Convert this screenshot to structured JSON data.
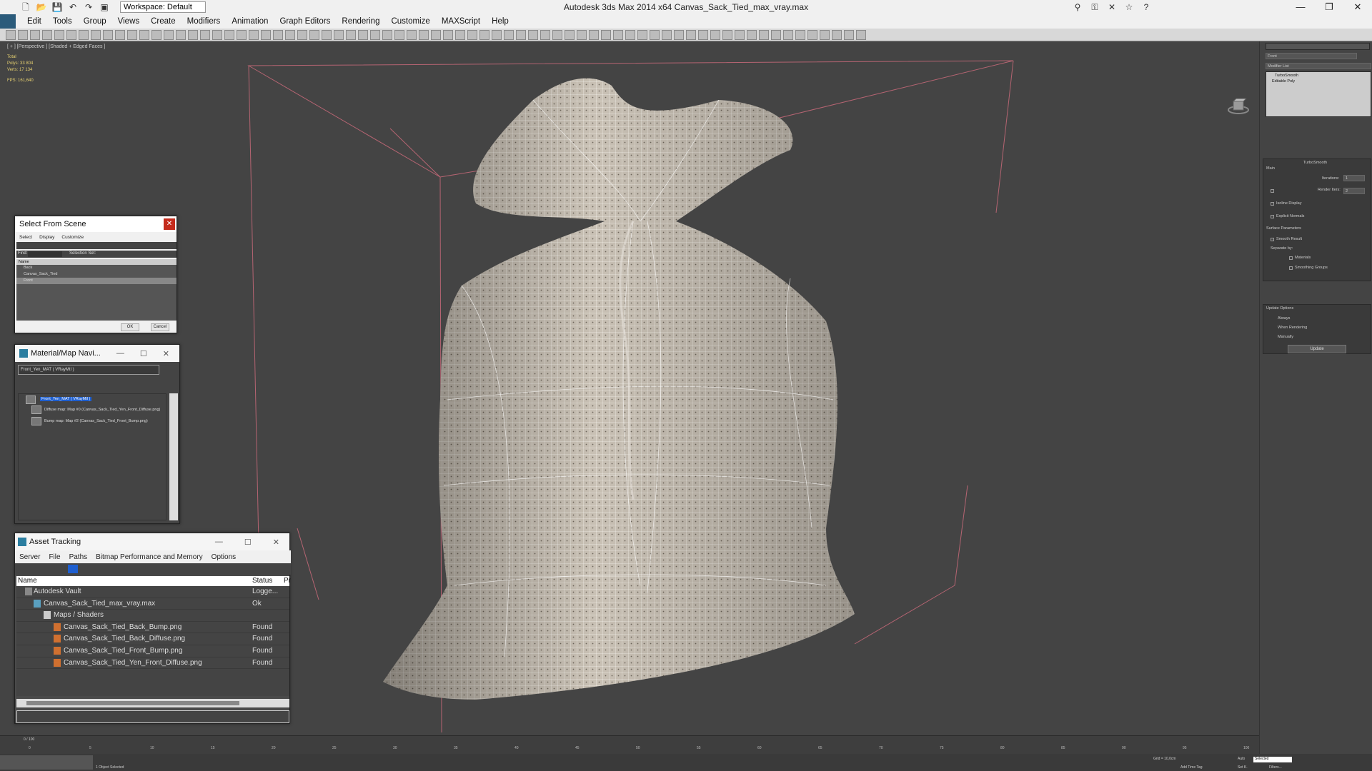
{
  "titlebar": {
    "title": "Autodesk 3ds Max  2014 x64     Canvas_Sack_Tied_max_vray.max",
    "workspace": "Workspace: Default",
    "min": "—",
    "max": "❐",
    "close": "✕"
  },
  "menubar": {
    "items": [
      "Edit",
      "Tools",
      "Group",
      "Views",
      "Create",
      "Modifiers",
      "Animation",
      "Graph Editors",
      "Rendering",
      "Customize",
      "MAXScript",
      "Help"
    ]
  },
  "viewport": {
    "label": "[ + ] [Perspective ] [Shaded + Edged Faces ]",
    "stats": {
      "total": "Total",
      "polys_label": "Polys:",
      "polys": "33 804",
      "verts_label": "Verts:",
      "verts": "17 134",
      "fps_label": "FPS:",
      "fps": "161,640"
    }
  },
  "select_from_scene": {
    "title": "Select From Scene",
    "close": "✕",
    "menus": [
      "Select",
      "Display",
      "Customize"
    ],
    "find_label": "Find:",
    "selection_set_label": "Selection Set:",
    "column_name": "Name",
    "rows": [
      "Back",
      "Canvas_Sack_Tied",
      "Front"
    ],
    "ok": "OK",
    "cancel": "Cancel"
  },
  "material_navigator": {
    "title": "Material/Map Navi...",
    "material_field": "Front_Yen_MAT ( VRayMtl )",
    "root": "Front_Yen_MAT ( VRayMtl )",
    "child1": "Diffuse map: Map #0 (Canvas_Sack_Tied_Yen_Front_Diffuse.png)",
    "child2": "Bump map: Map #2 (Canvas_Sack_Tied_Front_Bump.png)"
  },
  "asset_tracking": {
    "title": "Asset Tracking",
    "menus": [
      "Server",
      "File",
      "Paths",
      "Bitmap Performance and Memory",
      "Options"
    ],
    "col_name": "Name",
    "col_status": "Status",
    "col_pr": "Pr",
    "rows": [
      {
        "name": "Autodesk Vault",
        "status": "Logge..."
      },
      {
        "name": "Canvas_Sack_Tied_max_vray.max",
        "status": "Ok"
      },
      {
        "name": "Maps / Shaders",
        "status": ""
      },
      {
        "name": "Canvas_Sack_Tied_Back_Bump.png",
        "status": "Found"
      },
      {
        "name": "Canvas_Sack_Tied_Back_Diffuse.png",
        "status": "Found"
      },
      {
        "name": "Canvas_Sack_Tied_Front_Bump.png",
        "status": "Found"
      },
      {
        "name": "Canvas_Sack_Tied_Yen_Front_Diffuse.png",
        "status": "Found"
      }
    ]
  },
  "command_panel": {
    "object_name": "Front",
    "modifier_list": "Modifier List",
    "stack": [
      "TurboSmooth",
      "Editable Poly"
    ],
    "rollout_title": "TurboSmooth",
    "main": "Main",
    "iterations_label": "Iterations:",
    "iterations": "1",
    "render_iters_label": "Render Iters:",
    "render_iters": "2",
    "isoline": "Isoline Display",
    "explicit_normals": "Explicit Normals",
    "surface_params": "Surface Parameters",
    "smooth_result": "Smooth Result",
    "separate_by": "Separate by:",
    "materials": "Materials",
    "smoothing_groups": "Smoothing Groups",
    "update_options": "Update Options",
    "always": "Always",
    "when_rendering": "When Rendering",
    "manually": "Manually",
    "update_btn": "Update"
  },
  "timeline": {
    "frame": "0 / 100",
    "ticks": [
      "0",
      "5",
      "10",
      "15",
      "20",
      "25",
      "30",
      "35",
      "40",
      "45",
      "50",
      "55",
      "60",
      "65",
      "70",
      "75",
      "80",
      "85",
      "90",
      "95",
      "100"
    ]
  },
  "statusbar": {
    "objects": "1 Object Selected",
    "grid": "Grid = 10,0cm",
    "add_time_tag": "Add Time Tag",
    "auto": "Auto",
    "selected": "Selected",
    "set_k": "Set K.",
    "filters": "Filters..."
  },
  "colors": {
    "viewport_bg": "#444444",
    "sack": "#cfc8bd",
    "bbox": "#c96a7a"
  }
}
